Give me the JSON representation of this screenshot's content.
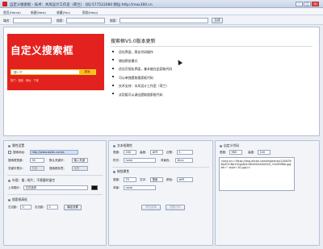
{
  "window": {
    "title": "自定义搜索框 - 技术：木风设计工作室（荷兰） QQ:577522080 网址:http://mox360.cn",
    "min": "–",
    "max": "□",
    "close": "×"
  },
  "menu": [
    "首页(Home)",
    "新建(New)",
    "收藏(Fav)",
    "帮助(Help)"
  ],
  "toolbar": {
    "site_label": "域名：",
    "search_label": "搜索：",
    "engine_label": "搜索：",
    "go_label": "生成"
  },
  "banner": {
    "title": "自定义搜索框",
    "input_text": "搜一下",
    "button": "搜索",
    "hotwords": "热门：搜索 · 网址 · 下载"
  },
  "update": {
    "title": "搜索框V5.0版本更新",
    "items": [
      "优化界面，简化代码操作",
      "增加预览模式",
      "优化可视化界面，基本能在此获取代码",
      "可以单独提取搜索框代码",
      "技术支持：木风设计工作室（荷兰）",
      "试用版可以调出提取搜索框代码"
    ]
  },
  "settings": {
    "title": "属性设置",
    "url_label": "搜索地址:",
    "url_value": "http://www.baidu.com/s",
    "width_label": "搜索框宽度:",
    "width_value": "30",
    "default_label": "默认关键字:",
    "default_value": "输入关键",
    "hot_label": "关键字提示:",
    "hot_value": "关闭",
    "tag_label": "搜索框标签:",
    "tag_value": "标签",
    "options_title": "外观：描 / 框片；不需要时留空",
    "image_label": "上传图片：",
    "image_value": "文件选择",
    "size_title": "搜索框高低",
    "left_label": "左边距:",
    "left_value": "0",
    "right_label": "右边距:",
    "right_value": "0",
    "apply_button": "确定设置"
  },
  "text_props": {
    "title": "文本框属性",
    "width_label": "宽度:",
    "width_value": "200",
    "height_label": "高度:",
    "height_value": "#fff",
    "border_label": "边框:",
    "border_value": "1",
    "style_label": "样式:",
    "style_value": "none",
    "color_label": "背景色:",
    "color_value": "#ccc",
    "btn_title": "按钮属性",
    "btn_width_label": "宽度:",
    "btn_width_value": "70",
    "btn_text_label": "文字:",
    "btn_text_value": "搜索",
    "btn_color_label": "颜色:",
    "btn_color_value": "#fff",
    "btn_bg_label": "背景:",
    "btn_bg_value": "none",
    "preview_button": "预览效果",
    "get_button": "提取代码"
  },
  "code": {
    "title": "自定义代码",
    "width_label": "宽度:",
    "width_value": "960",
    "height_label": "高度:",
    "height_value": "100",
    "content": "<img src='https://img.alicdn.com/imgextra/i1/2083960/O1CN01S2gc6z2r0HXXXXXXXXXX_!!2083960.jpg' alt='' style='01.jpg'/>"
  },
  "colors": {
    "banner": "#e3221f",
    "accent": "#f6c214"
  }
}
